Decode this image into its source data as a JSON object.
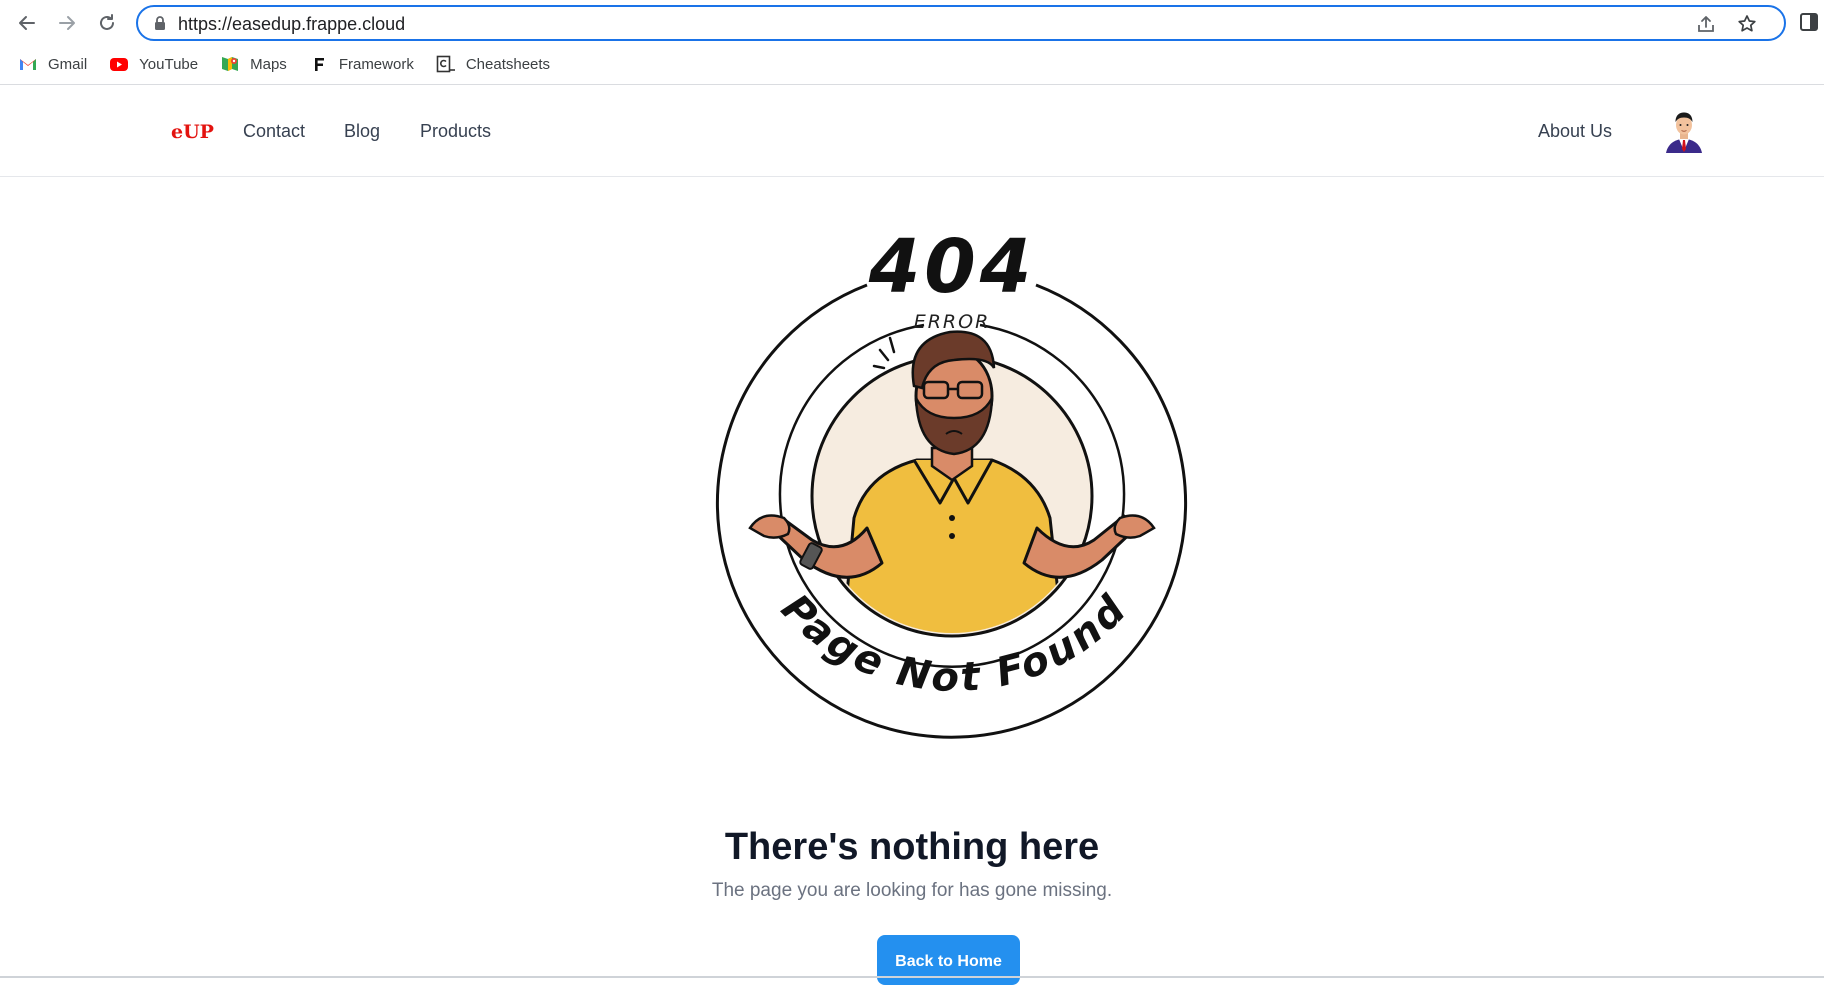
{
  "browser": {
    "url": "https://easedup.frappe.cloud",
    "bookmarks": [
      {
        "label": "Gmail",
        "icon": "gmail-icon"
      },
      {
        "label": "YouTube",
        "icon": "youtube-icon"
      },
      {
        "label": "Maps",
        "icon": "maps-icon"
      },
      {
        "label": "Framework",
        "icon": "frappe-icon"
      },
      {
        "label": "Cheatsheets",
        "icon": "cheatsheets-icon"
      }
    ]
  },
  "site": {
    "brand": "eUP",
    "brand_color": "#e3130f",
    "nav": {
      "contact": "Contact",
      "blog": "Blog",
      "products": "Products",
      "about": "About Us"
    }
  },
  "error": {
    "code": "404",
    "tag": "ERROR",
    "ring_text": "Page Not Found",
    "headline": "There's nothing here",
    "message": "The page you are looking for has gone missing.",
    "button": "Back to Home",
    "button_color": "#2490ef"
  }
}
